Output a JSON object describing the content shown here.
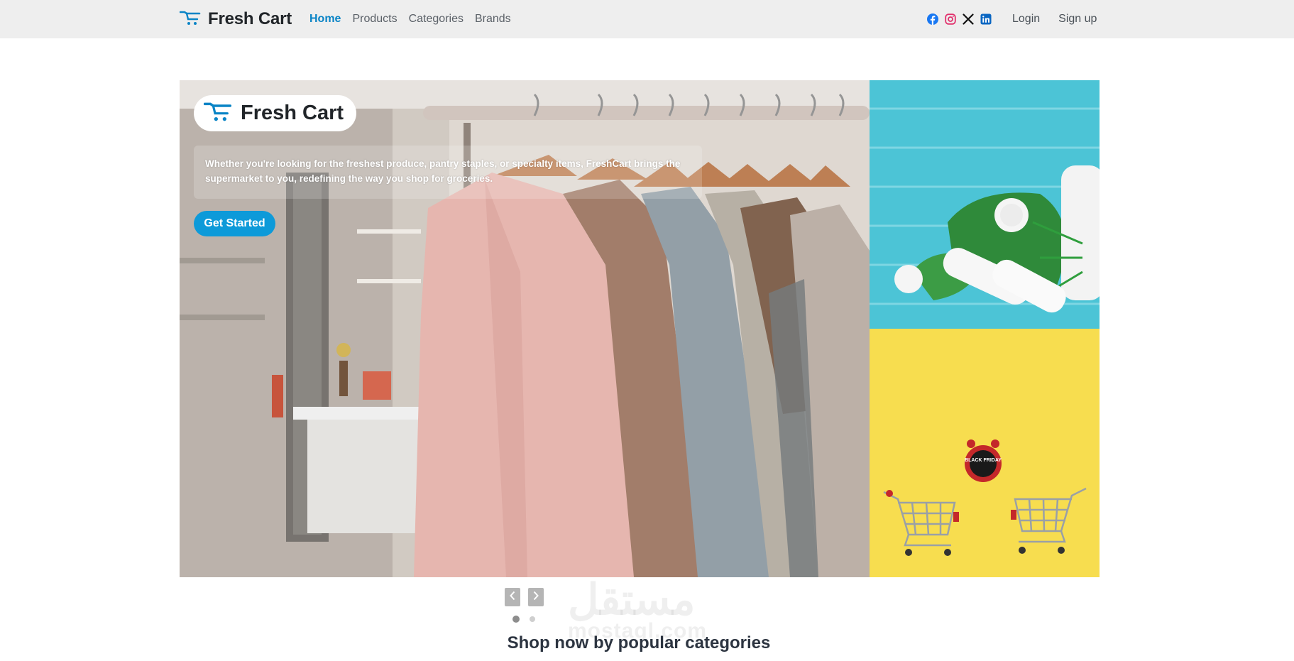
{
  "nav": {
    "brand": "Fresh Cart",
    "links": [
      {
        "label": "Home",
        "active": true
      },
      {
        "label": "Products",
        "active": false
      },
      {
        "label": "Categories",
        "active": false
      },
      {
        "label": "Brands",
        "active": false
      }
    ],
    "socials": [
      "facebook-icon",
      "instagram-icon",
      "x-icon",
      "linkedin-icon"
    ],
    "login": "Login",
    "signup": "Sign up"
  },
  "hero": {
    "logo_text": "Fresh Cart",
    "description": "Whether you're looking for the freshest produce, pantry staples, or specialty items, FreshCart brings the supermarket to you, redefining the way you shop for groceries.",
    "cta": "Get Started",
    "slide_count": 2,
    "active_slide": 1,
    "side_top_badge": "BLACK FRIDAY"
  },
  "section": {
    "title": "Shop now by popular categories"
  },
  "watermark": {
    "arabic": "مستقل",
    "latin": "mostaql.com"
  },
  "colors": {
    "accent": "#0a84c6",
    "button": "#0d9ad9",
    "navbar_bg": "#eeeeee"
  }
}
